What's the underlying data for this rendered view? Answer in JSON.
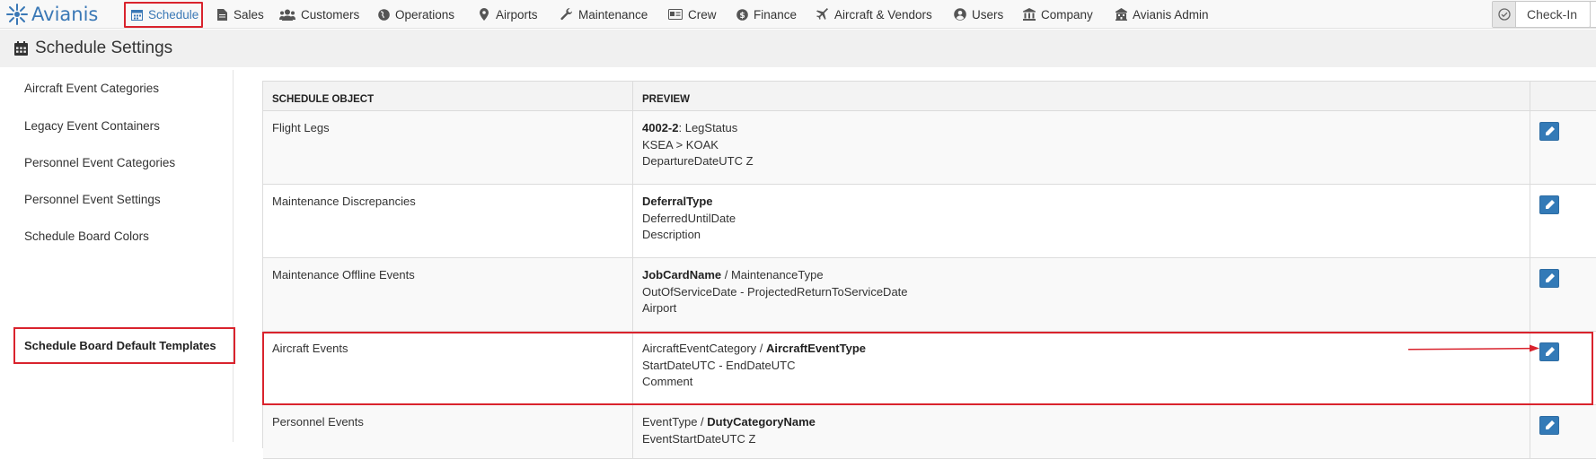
{
  "app": {
    "brand": "Avianis",
    "accent_color": "#3a78b6",
    "highlight_color": "#d9232d"
  },
  "nav": {
    "items": [
      {
        "label": "Schedule",
        "icon": "calendar-icon",
        "active": true
      },
      {
        "label": "Sales",
        "icon": "document-icon"
      },
      {
        "label": "Customers",
        "icon": "users-icon"
      },
      {
        "label": "Operations",
        "icon": "globe-icon"
      },
      {
        "label": "Airports",
        "icon": "map-marker-icon"
      },
      {
        "label": "Maintenance",
        "icon": "wrench-icon"
      },
      {
        "label": "Crew",
        "icon": "id-card-icon"
      },
      {
        "label": "Finance",
        "icon": "dollar-icon"
      },
      {
        "label": "Aircraft & Vendors",
        "icon": "plane-icon"
      },
      {
        "label": "Users",
        "icon": "user-circle-icon"
      },
      {
        "label": "Company",
        "icon": "bank-icon"
      },
      {
        "label": "Avianis Admin",
        "icon": "admin-building-icon"
      }
    ],
    "checkin_label": "Check-In"
  },
  "page": {
    "title": "Schedule Settings"
  },
  "sidebar": {
    "items": [
      {
        "label": "Aircraft Event Categories"
      },
      {
        "label": "Legacy Event Containers"
      },
      {
        "label": "Personnel Event Categories"
      },
      {
        "label": "Personnel Event Settings"
      },
      {
        "label": "Schedule Board Colors"
      },
      {
        "label": "Schedule Board Default Templates",
        "active": true
      }
    ]
  },
  "table": {
    "headers": {
      "object": "SCHEDULE OBJECT",
      "preview": "PREVIEW"
    },
    "rows": [
      {
        "object": "Flight Legs",
        "lines": [
          [
            {
              "text": "4002-2",
              "bold": true
            },
            {
              "text": ": LegStatus"
            }
          ],
          [
            {
              "text": "KSEA > KOAK"
            }
          ],
          [
            {
              "text": "DepartureDateUTC Z"
            }
          ]
        ]
      },
      {
        "object": "Maintenance Discrepancies",
        "lines": [
          [
            {
              "text": "DeferralType",
              "bold": true
            }
          ],
          [
            {
              "text": "DeferredUntilDate"
            }
          ],
          [
            {
              "text": "Description"
            }
          ]
        ]
      },
      {
        "object": "Maintenance Offline Events",
        "lines": [
          [
            {
              "text": "JobCardName",
              "bold": true
            },
            {
              "text": " / MaintenanceType"
            }
          ],
          [
            {
              "text": "OutOfServiceDate - ProjectedReturnToServiceDate"
            }
          ],
          [
            {
              "text": "Airport"
            }
          ]
        ]
      },
      {
        "object": "Aircraft Events",
        "highlighted": true,
        "lines": [
          [
            {
              "text": "AircraftEventCategory / "
            },
            {
              "text": "AircraftEventType",
              "bold": true
            }
          ],
          [
            {
              "text": "StartDateUTC - EndDateUTC"
            }
          ],
          [
            {
              "text": "Comment"
            }
          ]
        ]
      },
      {
        "object": "Personnel Events",
        "lines": [
          [
            {
              "text": "EventType / "
            },
            {
              "text": "DutyCategoryName",
              "bold": true
            }
          ],
          [
            {
              "text": "EventStartDateUTC Z"
            }
          ]
        ]
      }
    ]
  }
}
